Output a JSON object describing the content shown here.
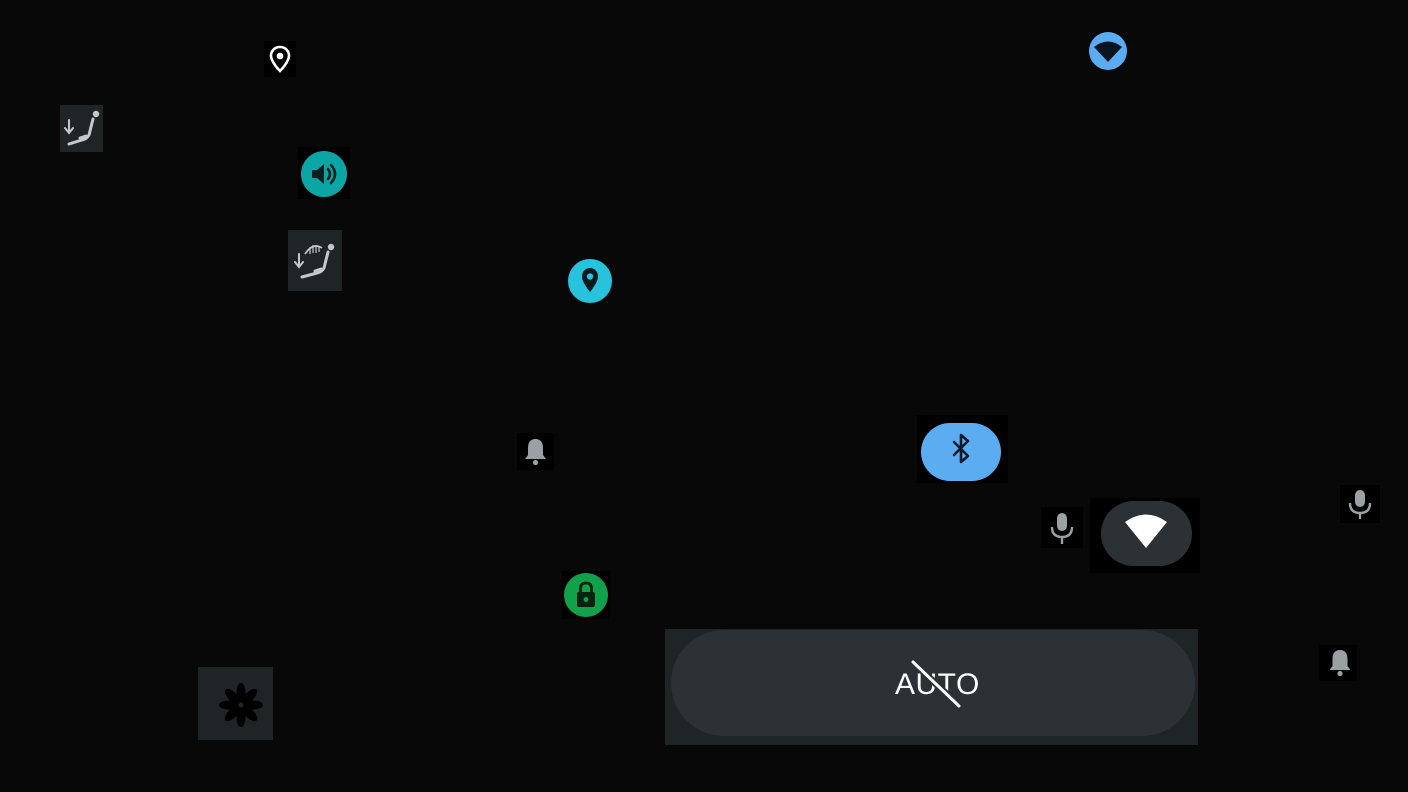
{
  "screen": {
    "background": "#080808",
    "icons": [
      {
        "name": "location-pin-outline-icon",
        "state": "white"
      },
      {
        "name": "seat-recline-icon",
        "state": "inactive"
      },
      {
        "name": "volume-icon",
        "state": "active",
        "color": "#0aa6a6"
      },
      {
        "name": "seat-heat-recline-icon",
        "state": "inactive"
      },
      {
        "name": "location-pin-icon",
        "state": "active",
        "color": "#27c3dc"
      },
      {
        "name": "notification-bell-icon",
        "state": "inactive"
      },
      {
        "name": "lock-icon",
        "state": "active",
        "color": "#12a04a"
      },
      {
        "name": "fan-icon",
        "state": "inactive"
      },
      {
        "name": "wifi-icon-top",
        "state": "active",
        "color": "#5cacf2"
      },
      {
        "name": "bluetooth-icon",
        "state": "active",
        "color": "#5cacf2"
      },
      {
        "name": "microphone-icon",
        "state": "inactive"
      },
      {
        "name": "wifi-icon",
        "state": "inactive"
      },
      {
        "name": "microphone-icon-right",
        "state": "inactive"
      },
      {
        "name": "notification-bell-icon-right",
        "state": "inactive"
      }
    ]
  },
  "auto_button": {
    "label": "AUTO",
    "state": "disabled"
  },
  "colors": {
    "tile": "#1f2427",
    "pill_dark": "#2c3136",
    "accent_blue": "#5cacf2",
    "accent_teal": "#0aa6a6",
    "accent_cyan": "#27c3dc",
    "accent_green": "#12a04a",
    "icon_gray": "#9aa0a4"
  }
}
